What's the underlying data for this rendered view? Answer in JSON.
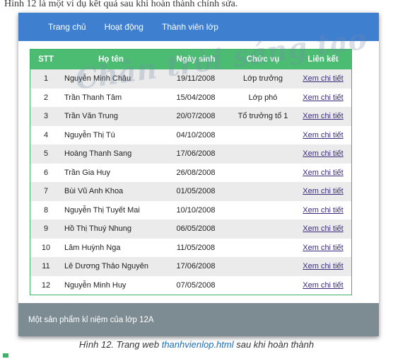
{
  "page": {
    "top_text": "Hình 12 là một ví dụ kết quả sau khi hoàn thành chỉnh sửa.",
    "caption_prefix": "Hình 12.  Trang web ",
    "caption_link": "thanhvienlop.html",
    "caption_suffix": " sau khi hoàn thành",
    "watermark": "Chân trời sáng tạo"
  },
  "nav": {
    "items": [
      "Trang chủ",
      "Hoạt động",
      "Thành viên lớp"
    ]
  },
  "table": {
    "headers": [
      "STT",
      "Họ tên",
      "Ngày sinh",
      "Chức vụ",
      "Liên kết"
    ],
    "rows": [
      {
        "stt": "1",
        "name": "Nguyễn Minh Châu",
        "dob": "19/11/2008",
        "role": "Lớp trưởng",
        "link": "Xem chi tiết"
      },
      {
        "stt": "2",
        "name": "Trần Thanh Tâm",
        "dob": "15/04/2008",
        "role": "Lớp phó",
        "link": "Xem chi tiết"
      },
      {
        "stt": "3",
        "name": "Trần Văn Trung",
        "dob": "20/07/2008",
        "role": "Tổ trưởng tổ 1",
        "link": "Xem chi tiết"
      },
      {
        "stt": "4",
        "name": "Nguyễn Thị Tú",
        "dob": "04/10/2008",
        "role": "",
        "link": "Xem chi tiết"
      },
      {
        "stt": "5",
        "name": "Hoàng Thanh Sang",
        "dob": "17/06/2008",
        "role": "",
        "link": "Xem chi tiết"
      },
      {
        "stt": "6",
        "name": "Trần Gia Huy",
        "dob": "26/08/2008",
        "role": "",
        "link": "Xem chi tiết"
      },
      {
        "stt": "7",
        "name": "Bùi Vũ Anh Khoa",
        "dob": "01/05/2008",
        "role": "",
        "link": "Xem chi tiết"
      },
      {
        "stt": "8",
        "name": "Nguyễn Thị Tuyết Mai",
        "dob": "10/10/2008",
        "role": "",
        "link": "Xem chi tiết"
      },
      {
        "stt": "9",
        "name": "Hồ Thị Thuý Nhung",
        "dob": "06/05/2008",
        "role": "",
        "link": "Xem chi tiết"
      },
      {
        "stt": "10",
        "name": "Lâm Huỳnh Nga",
        "dob": "11/05/2008",
        "role": "",
        "link": "Xem chi tiết"
      },
      {
        "stt": "11",
        "name": "Lê Dương Thảo Nguyên",
        "dob": "17/06/2008",
        "role": "",
        "link": "Xem chi tiết"
      },
      {
        "stt": "12",
        "name": "Nguyễn Minh Huy",
        "dob": "07/05/2008",
        "role": "",
        "link": "Xem chi tiết"
      }
    ]
  },
  "footer": {
    "text": "Một sản phẩm kỉ niệm của lớp 12A"
  },
  "colors": {
    "navbar": "#3f7fd0",
    "table_header": "#4cbc73",
    "table_border": "#3fb26a",
    "footer": "#7d8c93",
    "link": "#3a2b7a",
    "caption_link": "#1a6db8"
  }
}
